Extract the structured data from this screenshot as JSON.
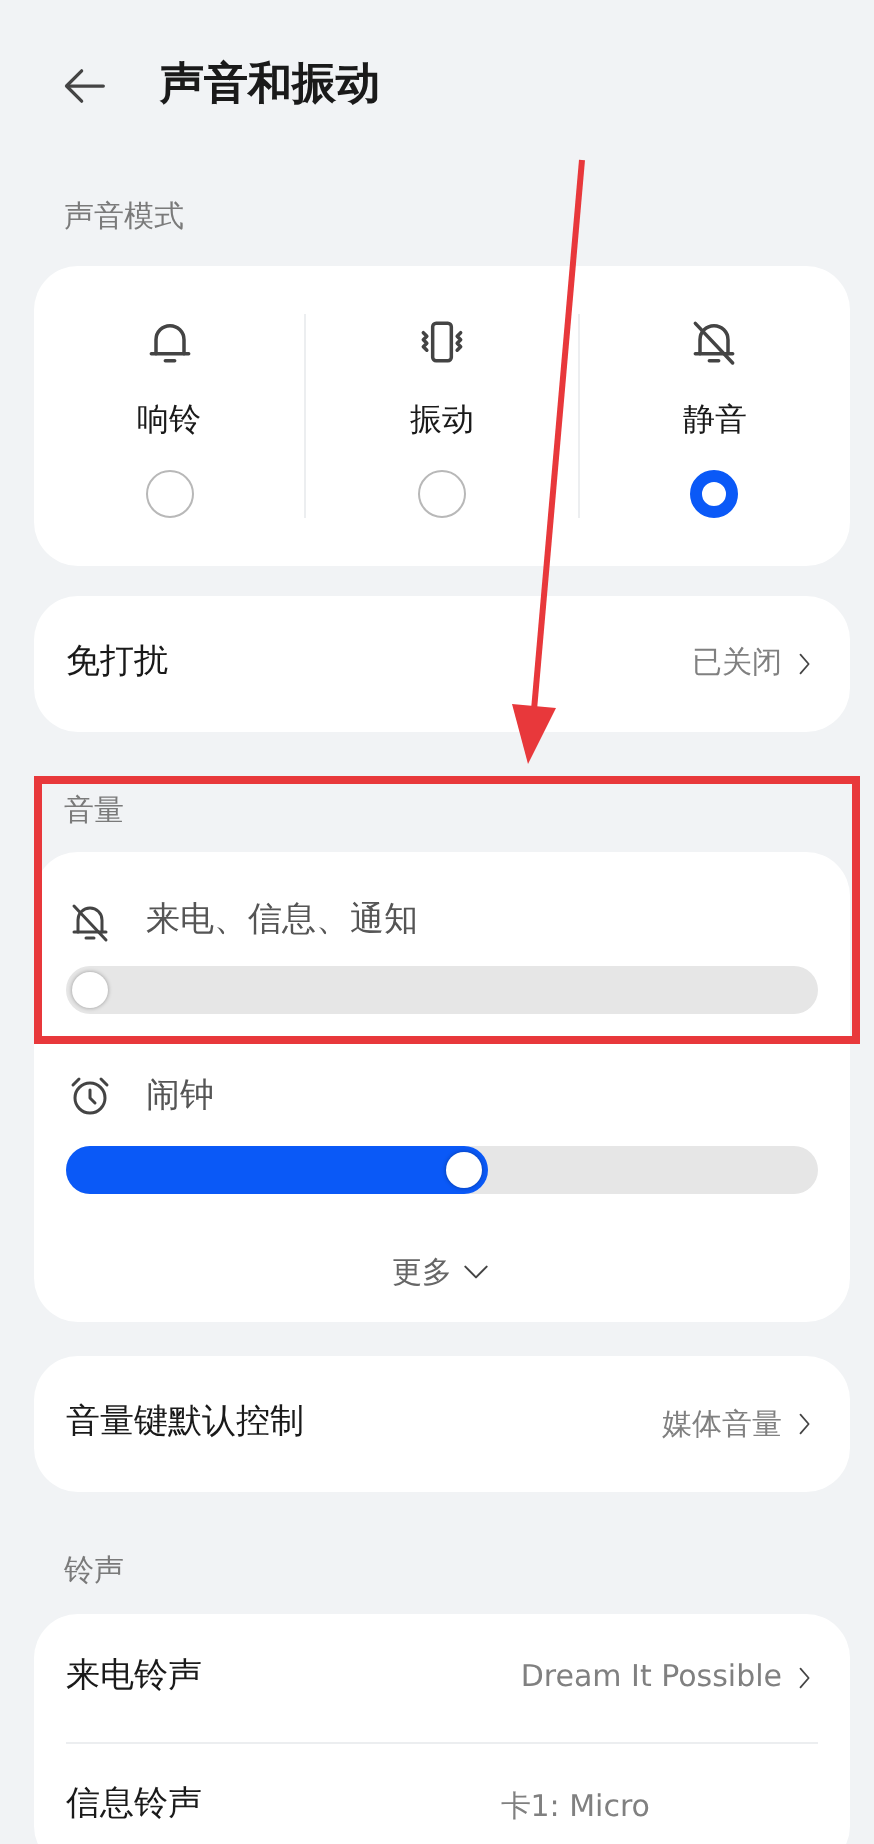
{
  "header": {
    "title": "声音和振动"
  },
  "sound_mode": {
    "label": "声音模式",
    "options": [
      {
        "kind": "ring",
        "label": "响铃",
        "selected": false
      },
      {
        "kind": "vibrate",
        "label": "振动",
        "selected": false
      },
      {
        "kind": "silent",
        "label": "静音",
        "selected": true
      }
    ]
  },
  "do_not_disturb": {
    "label": "免打扰",
    "value": "已关闭"
  },
  "volume": {
    "label": "音量",
    "sliders": [
      {
        "kind": "muted",
        "label": "来电、信息、通知",
        "level": 0
      },
      {
        "kind": "alarm",
        "label": "闹钟",
        "level": 0.56
      }
    ],
    "more": "更多"
  },
  "volume_key": {
    "label": "音量键默认控制",
    "value": "媒体音量"
  },
  "ringtones": {
    "label": "铃声",
    "items": [
      {
        "label": "来电铃声",
        "value": "Dream It Possible"
      },
      {
        "label": "信息铃声",
        "value": "卡1: Micro"
      }
    ]
  }
}
